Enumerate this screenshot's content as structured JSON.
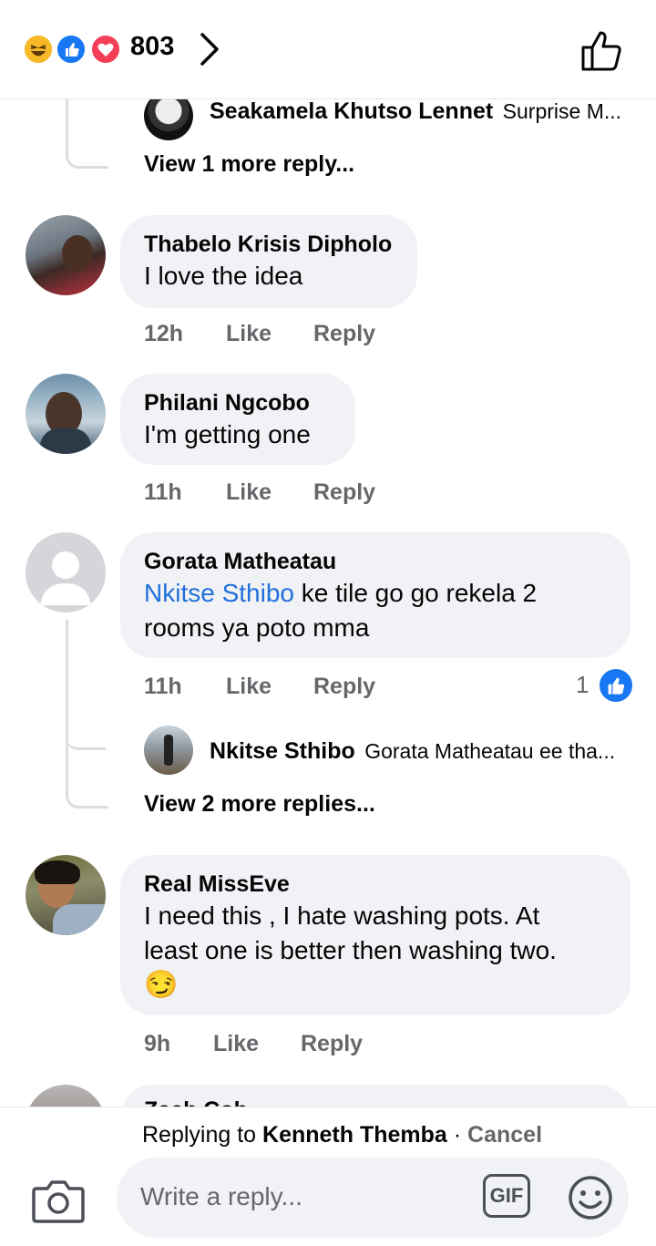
{
  "header": {
    "reaction_count": "803",
    "reaction_icons": [
      "laugh-emoji-icon",
      "like-reaction-icon",
      "love-reaction-icon"
    ],
    "chevron": "›",
    "like_icon": "thumbs-up-outline-icon"
  },
  "top_reply": {
    "name": "Seakamela Khutso Lennet",
    "snippet": "Surprise M..."
  },
  "view_more_1": "View 1 more reply...",
  "comments": [
    {
      "name": "Thabelo Krisis Dipholo",
      "text": "I love the idea",
      "time": "12h",
      "like": "Like",
      "reply": "Reply"
    },
    {
      "name": "Philani Ngcobo",
      "text": "I'm getting one",
      "time": "11h",
      "like": "Like",
      "reply": "Reply"
    },
    {
      "name": "Gorata Matheatau",
      "mention": "Nkitse Sthibo",
      "text_line1": " ke tile go go rekela 2",
      "text_line2": "rooms ya poto mma",
      "time": "11h",
      "like": "Like",
      "reply": "Reply",
      "reaction_count": "1"
    },
    {
      "name": "Real MissEve",
      "text_line1": "I need this , I hate washing pots. At",
      "text_line2": "least one is better then washing two.",
      "emoji": "😏",
      "time": "9h",
      "like": "Like",
      "reply": "Reply"
    }
  ],
  "nested_reply": {
    "name": "Nkitse Sthibo",
    "snippet": "Gorata Matheatau ee tha..."
  },
  "view_more_2": "View 2 more replies...",
  "partial_name": "Zach Cob...",
  "composer": {
    "replying_prefix": "Replying to ",
    "replying_name": "Kenneth Themba",
    "separator": " · ",
    "cancel": "Cancel",
    "placeholder": "Write a reply...",
    "gif_label": "GIF"
  },
  "colors": {
    "brand_blue": "#1877f2",
    "link_blue": "#216fdb",
    "bubble_gray": "#f0f2f5",
    "meta_gray": "#65676b",
    "love_red": "#f33e58",
    "haha_yellow": "#f7b928"
  }
}
